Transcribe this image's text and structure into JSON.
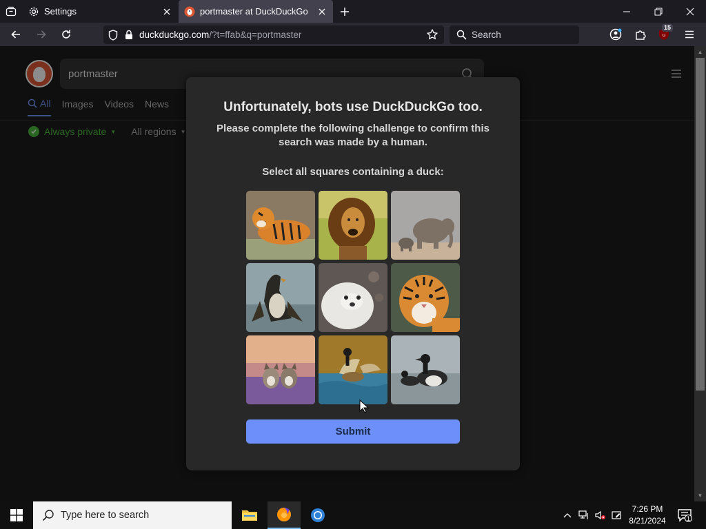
{
  "browser": {
    "tabs": [
      {
        "label": "Settings",
        "icon": "gear-icon"
      },
      {
        "label": "portmaster at DuckDuckGo",
        "icon": "duckduckgo-favicon",
        "active": true
      }
    ],
    "url": {
      "host": "duckduckgo.com",
      "path": "/?t=ffab&q=portmaster"
    },
    "search_placeholder": "Search",
    "extension_badge": "15"
  },
  "ddg": {
    "query": "portmaster",
    "tabs": [
      "All",
      "Images",
      "Videos",
      "News"
    ],
    "filters": {
      "privacy": "Always private",
      "region": "All regions"
    }
  },
  "challenge": {
    "title": "Unfortunately, bots use DuckDuckGo too.",
    "subtitle": "Please complete the following challenge to confirm this search was made by a human.",
    "prompt": "Select all squares containing a duck:",
    "images": [
      "tiger",
      "lion",
      "elephants",
      "duck",
      "seal",
      "tiger",
      "dogs",
      "duck",
      "ducks"
    ],
    "submit_label": "Submit"
  },
  "taskbar": {
    "search_placeholder": "Type here to search",
    "time": "7:26 PM",
    "date": "8/21/2024",
    "notification_count": "1"
  },
  "colors": {
    "accent": "#6d8ff9",
    "ddg_orange": "#de5833",
    "private_green": "#4cba3c"
  }
}
